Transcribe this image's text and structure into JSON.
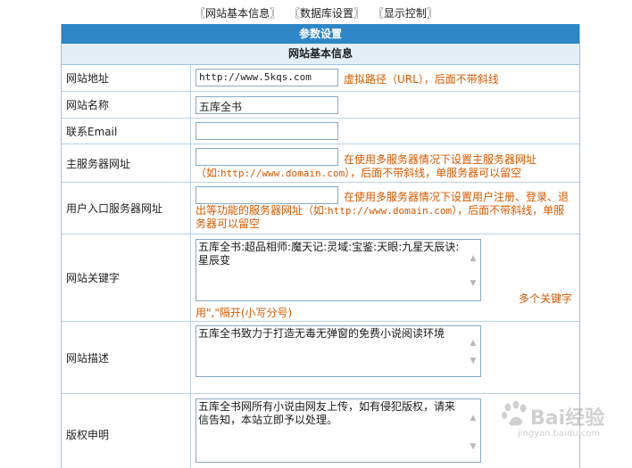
{
  "nav": {
    "items": [
      "〖网站基本信息〗",
      "〖数据库设置〗",
      "〖显示控制〗"
    ]
  },
  "panel": {
    "title": "参数设置",
    "section": "网站基本信息"
  },
  "fields": {
    "site_url": {
      "label": "网站地址",
      "value": "http://www.5kqs.com",
      "hint": "虚拟路径（URL），后面不带斜线"
    },
    "site_name": {
      "label": "网站名称",
      "value": "五库全书"
    },
    "email": {
      "label": "联系Email",
      "value": ""
    },
    "main_server": {
      "label": "主服务器网址",
      "value": "",
      "hint_pre": "在使用多服务器情况下设置主服务器网址（如:",
      "hint_url": "http://www.domain.com",
      "hint_post": "），后面不带斜线，单服务器可以留空"
    },
    "user_server": {
      "label": "用户入口服务器网址",
      "value": "",
      "hint_pre": "在使用多服务器情况下设置用户注册、登录、退出等功能的服务器网址（如:",
      "hint_url": "http://www.domain.com",
      "hint_post": "），后面不带斜线，单服务器可以留空"
    },
    "keywords": {
      "label": "网站关键字",
      "value": "五库全书:超品相师:魔天记:灵域:宝鉴:天眼:九星天辰诀:星辰变",
      "hint_a": "多个关键字",
      "hint_b": "用\",\"隔开(小写分号)"
    },
    "description": {
      "label": "网站描述",
      "value": "五库全书致力于打造无毒无弹窗的免费小说阅读环境"
    },
    "copyright": {
      "label": "版权申明",
      "value": "五库全书网所有小说由网友上传，如有侵犯版权，请来信告知，本站立即予以处理。"
    }
  },
  "watermark": {
    "brand": "Bai经验",
    "url": "jingyan.baidu.com"
  },
  "colors": {
    "title_bg": "#2e86c6",
    "hint": "#d55a00",
    "border": "#b9d1e4"
  },
  "icons": [
    "scroll-up-icon",
    "scroll-down-icon",
    "baidu-paw-icon"
  ]
}
